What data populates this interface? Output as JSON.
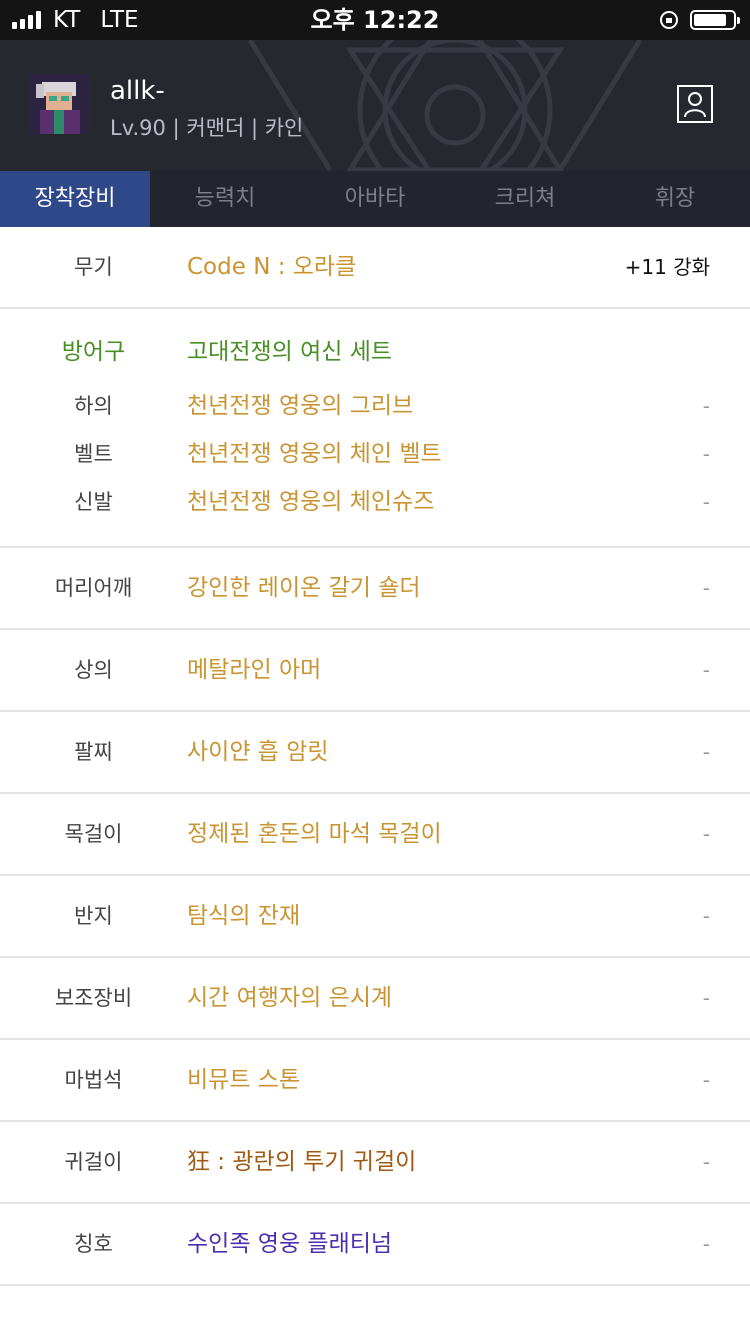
{
  "status_bar": {
    "carrier": "KT",
    "network": "LTE",
    "time": "오후 12:22",
    "battery_level": 0.85,
    "icons": [
      "signal-icon",
      "rotation-lock-icon",
      "battery-icon"
    ]
  },
  "profile": {
    "name": "allk-",
    "info": "Lv.90 | 커맨더 | 카인",
    "avatar_icon": "character-avatar-icon",
    "button_icon": "profile-icon"
  },
  "tabs": [
    {
      "label": "장착장비",
      "active": true
    },
    {
      "label": "능력치",
      "active": false
    },
    {
      "label": "아바타",
      "active": false
    },
    {
      "label": "크리쳐",
      "active": false
    },
    {
      "label": "휘장",
      "active": false
    }
  ],
  "weapon": {
    "slot": "무기",
    "name": "Code N : 오라클",
    "enhance": "+11 강화"
  },
  "armor_set": {
    "label": "방어구",
    "set_name": "고대전쟁의 여신 세트",
    "items": [
      {
        "slot": "하의",
        "name": "천년전쟁 영웅의 그리브",
        "extra": "-"
      },
      {
        "slot": "벨트",
        "name": "천년전쟁 영웅의 체인 벨트",
        "extra": "-"
      },
      {
        "slot": "신발",
        "name": "천년전쟁 영웅의 체인슈즈",
        "extra": "-"
      }
    ]
  },
  "equipment": [
    {
      "slot": "머리어깨",
      "name": "강인한 레이온 갈기 숄더",
      "extra": "-",
      "grade": "unique"
    },
    {
      "slot": "상의",
      "name": "메탈라인 아머",
      "extra": "-",
      "grade": "unique"
    },
    {
      "slot": "팔찌",
      "name": "사이얀 흡 암릿",
      "extra": "-",
      "grade": "unique"
    },
    {
      "slot": "목걸이",
      "name": "정제된 혼돈의 마석 목걸이",
      "extra": "-",
      "grade": "unique"
    },
    {
      "slot": "반지",
      "name": "탐식의 잔재",
      "extra": "-",
      "grade": "unique"
    },
    {
      "slot": "보조장비",
      "name": "시간 여행자의 은시계",
      "extra": "-",
      "grade": "unique"
    },
    {
      "slot": "마법석",
      "name": "비뮤트 스톤",
      "extra": "-",
      "grade": "unique"
    },
    {
      "slot": "귀걸이",
      "name": "狂 : 광란의 투기 귀걸이",
      "extra": "-",
      "grade": "epic"
    },
    {
      "slot": "칭호",
      "name": "수인족 영웅 플래티넘",
      "extra": "-",
      "grade": "title"
    }
  ],
  "colors": {
    "unique": "#c99431",
    "set": "#4a8f26",
    "epic": "#a15a14",
    "title": "#4a2fb0",
    "tab_active": "#2f4889",
    "header_bg": "#262830"
  }
}
